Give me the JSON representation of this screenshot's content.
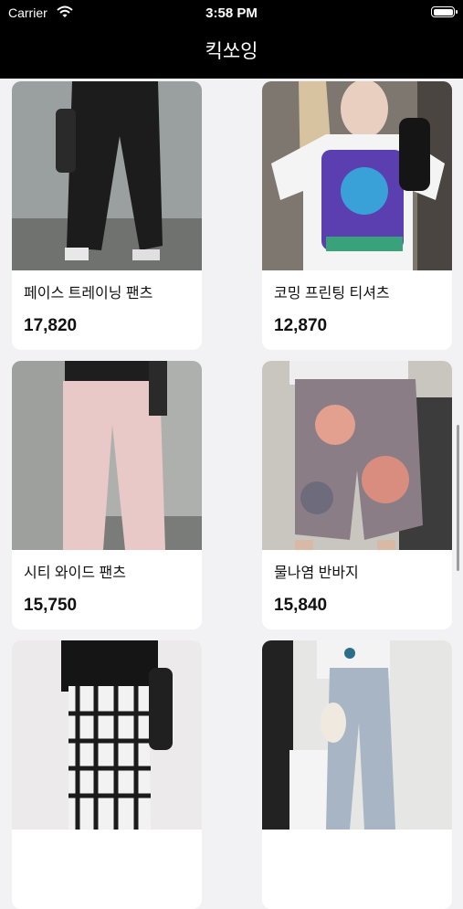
{
  "status_bar": {
    "carrier": "Carrier",
    "time": "3:58 PM"
  },
  "app": {
    "title": "킥쏘잉"
  },
  "products": [
    {
      "name": "페이스 트레이닝 팬츠",
      "price": "17,820"
    },
    {
      "name": "코밍 프린팅 티셔츠",
      "price": "12,870"
    },
    {
      "name": "시티 와이드 팬츠",
      "price": "15,750"
    },
    {
      "name": "물나염 반바지",
      "price": "15,840"
    },
    {
      "name": "",
      "price": ""
    },
    {
      "name": "",
      "price": ""
    }
  ],
  "colors": {
    "header_bg": "#000000",
    "page_bg": "#f2f2f4",
    "card_bg": "#ffffff"
  }
}
